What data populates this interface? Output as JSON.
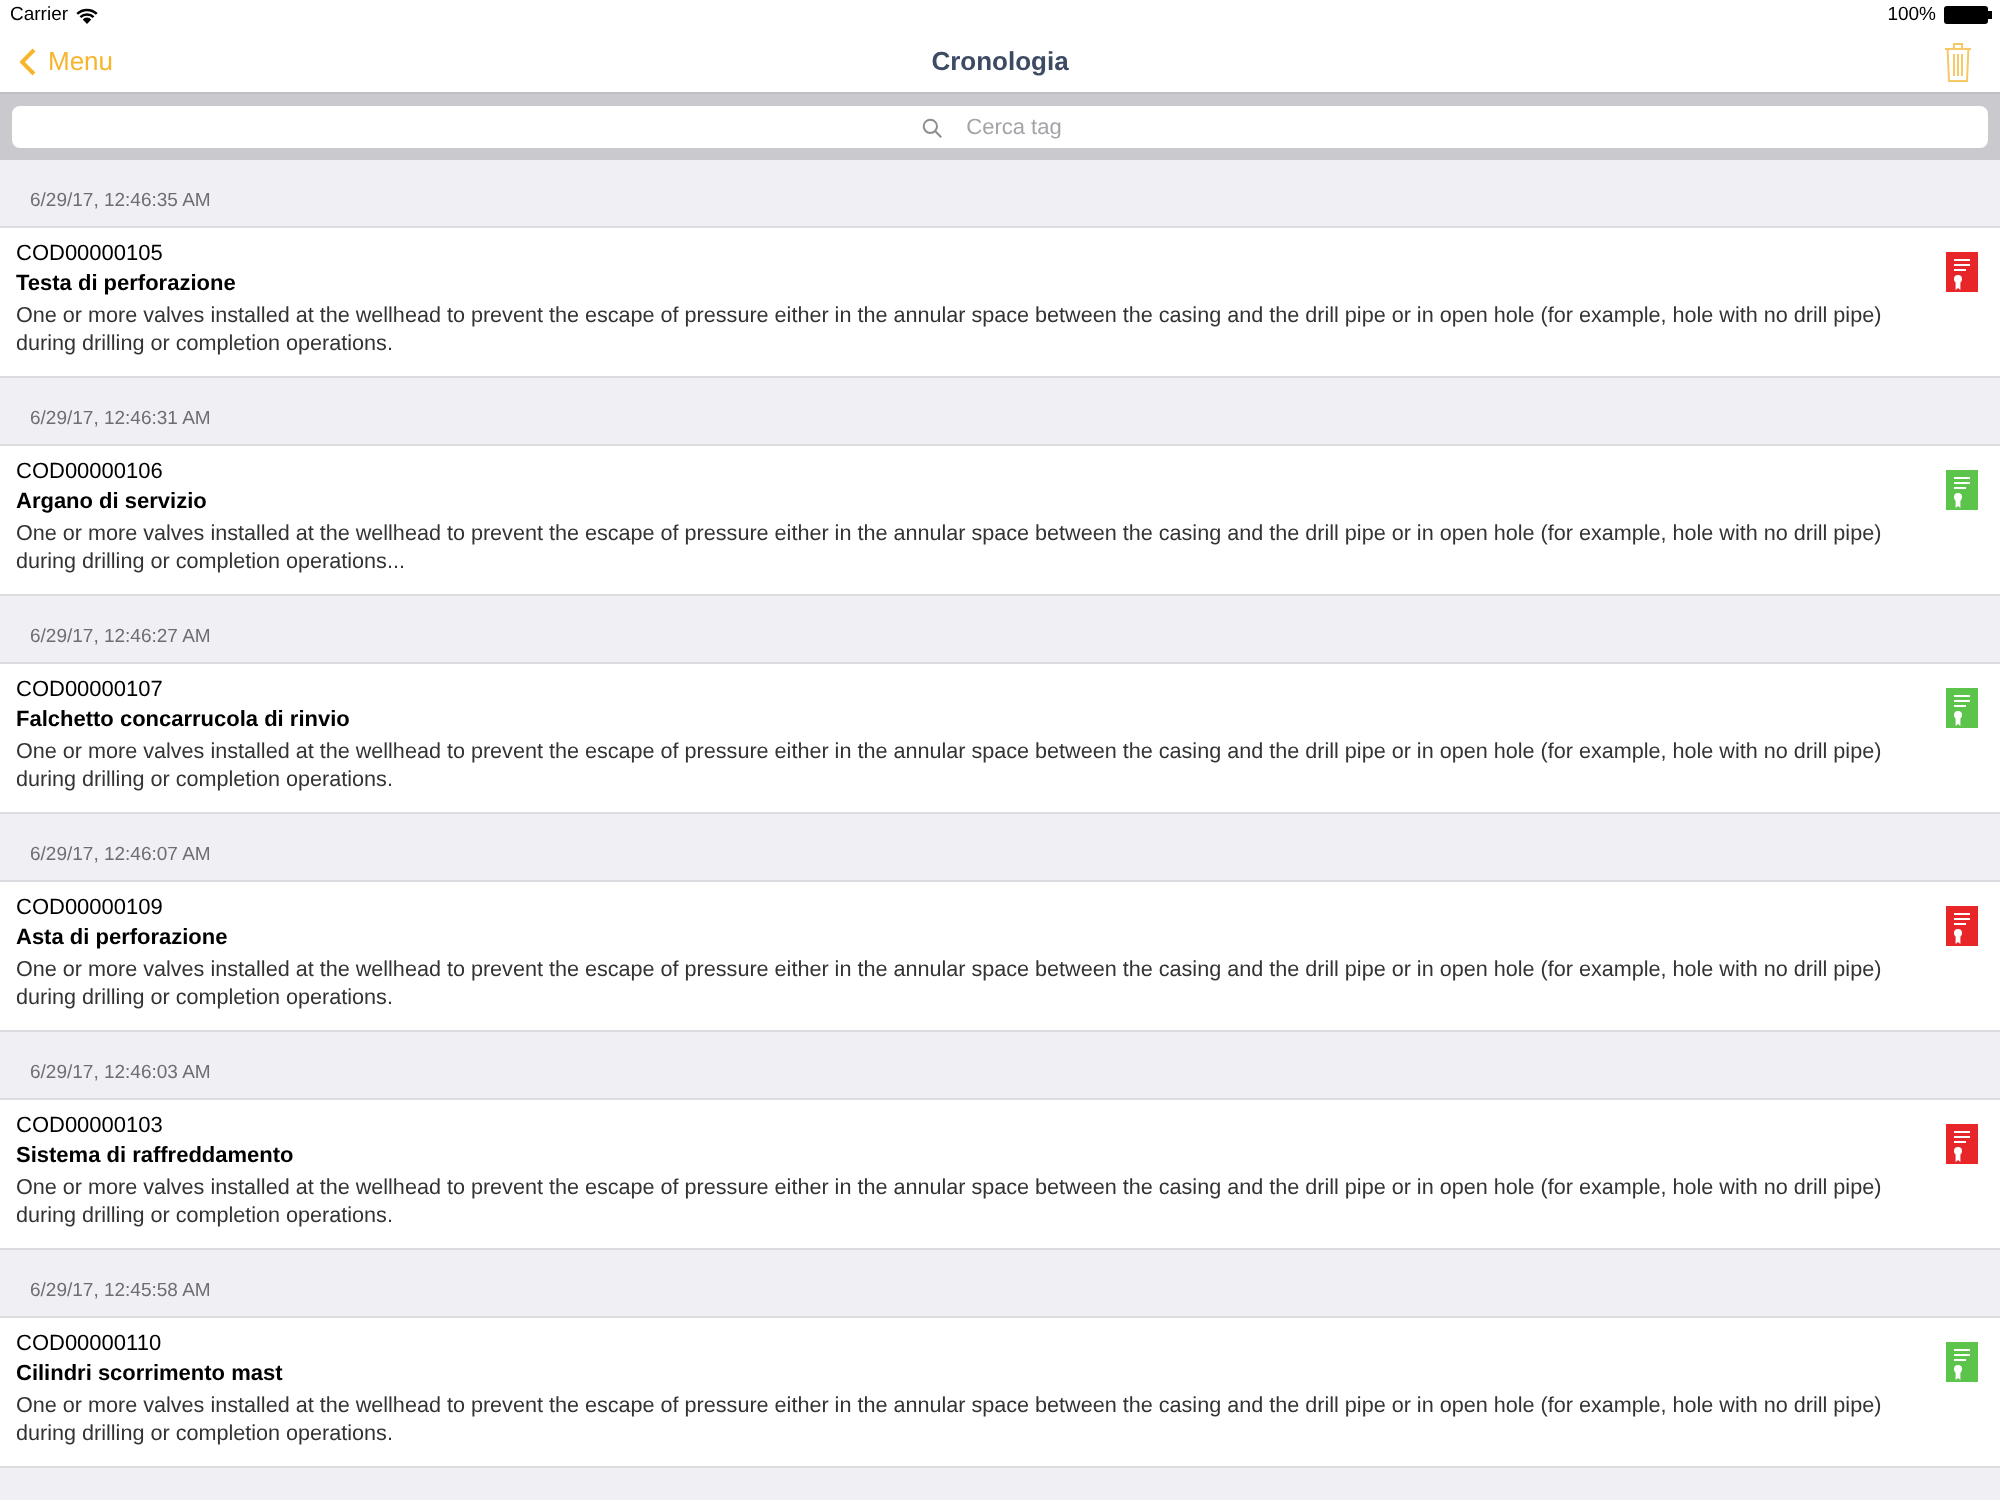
{
  "status_bar": {
    "carrier": "Carrier",
    "battery": "100%"
  },
  "nav": {
    "back": "Menu",
    "title": "Cronologia"
  },
  "search": {
    "placeholder": "Cerca tag"
  },
  "entries": [
    {
      "timestamp": "6/29/17, 12:46:35 AM",
      "code": "COD00000105",
      "name": "Testa di perforazione",
      "description": "One or more valves installed at the wellhead to prevent the escape of pressure either in the annular space between the casing and the drill pipe or in open hole (for example, hole with no drill pipe) during drilling or completion operations.",
      "color": "#e8262a"
    },
    {
      "timestamp": "6/29/17, 12:46:31 AM",
      "code": "COD00000106",
      "name": "Argano di servizio",
      "description": "One or more valves installed at the wellhead to prevent the escape of pressure either in the annular space between the casing and the drill pipe or in open hole (for example, hole with no drill pipe) during drilling or completion operations...",
      "color": "#5cc44a"
    },
    {
      "timestamp": "6/29/17, 12:46:27 AM",
      "code": "COD00000107",
      "name": "Falchetto concarrucola di rinvio",
      "description": "One or more valves installed at the wellhead to prevent the escape of pressure either in the annular space between the casing and the drill pipe or in open hole (for example, hole with no drill pipe) during drilling or completion operations.",
      "color": "#5cc44a"
    },
    {
      "timestamp": "6/29/17, 12:46:07 AM",
      "code": "COD00000109",
      "name": "Asta di perforazione",
      "description": "One or more valves installed at the wellhead to prevent the escape of pressure either in the annular space between the casing and the drill pipe or in open hole (for example, hole with no drill pipe) during drilling or completion operations.",
      "color": "#e8262a"
    },
    {
      "timestamp": "6/29/17, 12:46:03 AM",
      "code": "COD00000103",
      "name": "Sistema di raffreddamento",
      "description": "One or more valves installed at the wellhead to prevent the escape of pressure either in the annular space between the casing and the drill pipe or in open hole (for example, hole with no drill pipe) during drilling or completion operations.",
      "color": "#e8262a"
    },
    {
      "timestamp": "6/29/17, 12:45:58 AM",
      "code": "COD00000110",
      "name": "Cilindri scorrimento mast",
      "description": "One or more valves installed at the wellhead to prevent the escape of pressure either in the annular space between the casing and the drill pipe or in open hole (for example, hole with no drill pipe) during drilling or completion operations.",
      "color": "#5cc44a"
    }
  ]
}
